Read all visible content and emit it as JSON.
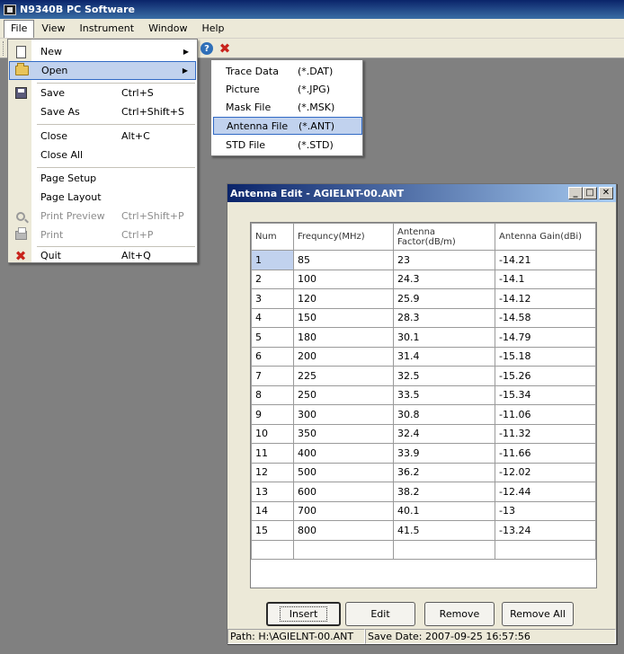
{
  "app": {
    "title": "N9340B PC Software"
  },
  "menubar": [
    {
      "label": "File"
    },
    {
      "label": "View"
    },
    {
      "label": "Instrument"
    },
    {
      "label": "Window"
    },
    {
      "label": "Help"
    }
  ],
  "file_menu": {
    "items": [
      {
        "label": "New",
        "shortcut": "",
        "icon": "new-document-icon",
        "submenu": true
      },
      {
        "label": "Open",
        "shortcut": "",
        "icon": "open-folder-icon",
        "submenu": true
      },
      {
        "label": "Save",
        "shortcut": "Ctrl+S",
        "icon": "save-icon"
      },
      {
        "label": "Save As",
        "shortcut": "Ctrl+Shift+S"
      },
      {
        "label": "Close",
        "shortcut": "Alt+C"
      },
      {
        "label": "Close All",
        "shortcut": ""
      },
      {
        "label": "Page Setup",
        "shortcut": ""
      },
      {
        "label": "Page Layout",
        "shortcut": ""
      },
      {
        "label": "Print Preview",
        "shortcut": "Ctrl+Shift+P",
        "icon": "magnifier-icon",
        "disabled": true
      },
      {
        "label": "Print",
        "shortcut": "Ctrl+P",
        "icon": "printer-icon",
        "disabled": true
      },
      {
        "label": "Quit",
        "shortcut": "Alt+Q",
        "icon": "quit-icon"
      }
    ]
  },
  "open_submenu": {
    "items": [
      {
        "label": "Trace Data",
        "ext": "(*.DAT)"
      },
      {
        "label": "Picture",
        "ext": "(*.JPG)"
      },
      {
        "label": "Mask File",
        "ext": "(*.MSK)"
      },
      {
        "label": "Antenna File",
        "ext": "(*.ANT)"
      },
      {
        "label": "STD File",
        "ext": "(*.STD)"
      }
    ]
  },
  "child": {
    "title": "Antenna Edit - AGIELNT-00.ANT",
    "columns": [
      "Num",
      "Frequncy(MHz)",
      "Antenna Factor(dB/m)",
      "Antenna Gain(dBi)"
    ],
    "rows": [
      [
        "1",
        "85",
        "23",
        "-14.21"
      ],
      [
        "2",
        "100",
        "24.3",
        "-14.1"
      ],
      [
        "3",
        "120",
        "25.9",
        "-14.12"
      ],
      [
        "4",
        "150",
        "28.3",
        "-14.58"
      ],
      [
        "5",
        "180",
        "30.1",
        "-14.79"
      ],
      [
        "6",
        "200",
        "31.4",
        "-15.18"
      ],
      [
        "7",
        "225",
        "32.5",
        "-15.26"
      ],
      [
        "8",
        "250",
        "33.5",
        "-15.34"
      ],
      [
        "9",
        "300",
        "30.8",
        "-11.06"
      ],
      [
        "10",
        "350",
        "32.4",
        "-11.32"
      ],
      [
        "11",
        "400",
        "33.9",
        "-11.66"
      ],
      [
        "12",
        "500",
        "36.2",
        "-12.02"
      ],
      [
        "13",
        "600",
        "38.2",
        "-12.44"
      ],
      [
        "14",
        "700",
        "40.1",
        "-13"
      ],
      [
        "15",
        "800",
        "41.5",
        "-13.24"
      ],
      [
        "",
        "",
        "",
        ""
      ]
    ],
    "buttons": {
      "insert": "Insert",
      "edit": "Edit",
      "remove": "Remove",
      "remove_all": "Remove All"
    },
    "status": {
      "path": "Path: H:\\AGIELNT-00.ANT",
      "save_date": "Save Date: 2007-09-25 16:57:56"
    }
  },
  "colors": {
    "title_bar": "#0a246a",
    "menu_highlight": "#c1d2ee",
    "desktop": "#808080"
  }
}
